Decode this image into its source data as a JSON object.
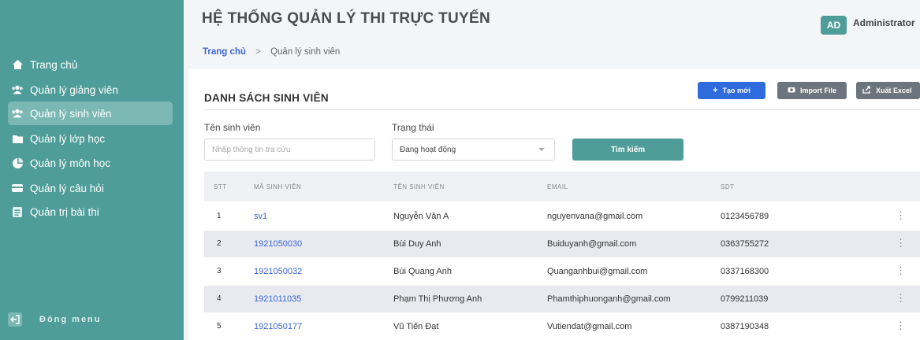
{
  "app_title": "HỆ THỐNG QUẢN LÝ THI TRỰC TUYẾN",
  "user": {
    "initials": "AD",
    "name": "Administrator"
  },
  "breadcrumb": {
    "home": "Trang chủ",
    "separator": ">",
    "current": "Quản lý sinh viên"
  },
  "sidebar": {
    "items": [
      {
        "label": "Trang chủ",
        "icon": "home-icon"
      },
      {
        "label": "Quản lý giảng viên",
        "icon": "users-icon"
      },
      {
        "label": "Quản lý sinh viên",
        "icon": "users-icon",
        "active": true
      },
      {
        "label": "Quản lý lớp học",
        "icon": "folder-icon"
      },
      {
        "label": "Quản lý môn học",
        "icon": "pie-chart-icon"
      },
      {
        "label": "Quản lý câu hỏi",
        "icon": "card-icon"
      },
      {
        "label": "Quản trị bài thi",
        "icon": "document-icon"
      }
    ],
    "collapse_label": "Đóng menu"
  },
  "panel": {
    "title": "DANH SÁCH SINH VIÊN",
    "buttons": {
      "new": "Tạo mới",
      "import": "Import File",
      "export": "Xuất Excel"
    }
  },
  "filters": {
    "name_label": "Tên sinh viên",
    "name_placeholder": "Nhập thông tin tra cứu",
    "status_label": "Trạng thái",
    "status_value": "Đang hoạt động",
    "search_button": "Tìm kiếm"
  },
  "table": {
    "columns": [
      "STT",
      "MÃ SINH VIÊN",
      "TÊN SINH VIÊN",
      "EMAIL",
      "SDT"
    ],
    "rows": [
      {
        "stt": "1",
        "ma": "sv1",
        "ten": "Nguyễn Văn A",
        "email": "nguyenvana@gmail.com",
        "sdt": "0123456789"
      },
      {
        "stt": "2",
        "ma": "1921050030",
        "ten": "Bùi Duy Anh",
        "email": "Buiduyanh@gmail.com",
        "sdt": "0363755272"
      },
      {
        "stt": "3",
        "ma": "1921050032",
        "ten": "Bùi Quang Anh",
        "email": "Quanganhbui@gmail.com",
        "sdt": "0337168300"
      },
      {
        "stt": "4",
        "ma": "1921011035",
        "ten": "Phạm Thị Phương Anh",
        "email": "Phamthiphuonganh@gmail.com",
        "sdt": "0799211039"
      },
      {
        "stt": "5",
        "ma": "1921050177",
        "ten": "Vũ Tiến Đạt",
        "email": "Vutiendat@gmail.com",
        "sdt": "0387190348"
      }
    ]
  },
  "colors": {
    "sidebar": "#4f9d99",
    "primary": "#2f6bdc",
    "secondary": "#6c757d",
    "link": "#3b66d8"
  }
}
